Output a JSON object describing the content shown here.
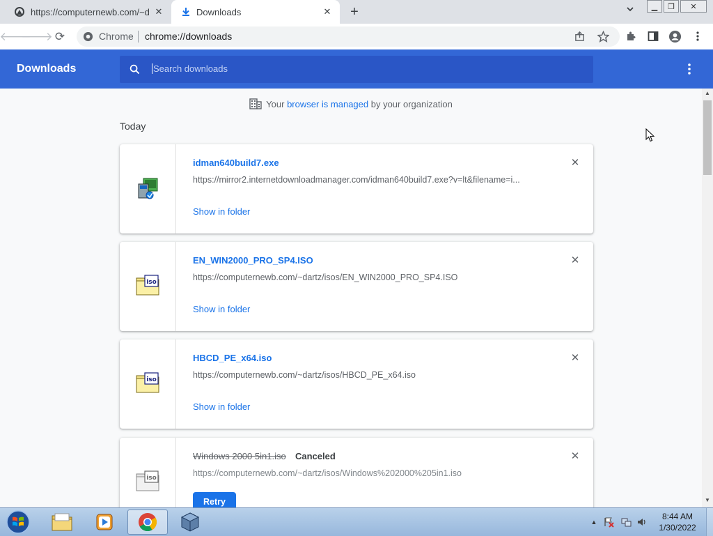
{
  "tabs": [
    {
      "title": "https://computernewb.com/~dartz",
      "active": false
    },
    {
      "title": "Downloads",
      "active": true
    }
  ],
  "toolbar": {
    "omnibox_label": "Chrome",
    "omnibox_url": "chrome://downloads"
  },
  "header": {
    "title": "Downloads",
    "search_placeholder": "Search downloads"
  },
  "managed": {
    "prefix": "Your ",
    "link": "browser is managed",
    "suffix": " by your organization"
  },
  "section_label": "Today",
  "downloads": [
    {
      "name": "idman640build7.exe",
      "url": "https://mirror2.internetdownloadmanager.com/idman640build7.exe?v=lt&filename=i...",
      "action": "Show in folder",
      "icon": "exe-installer-icon"
    },
    {
      "name": "EN_WIN2000_PRO_SP4.ISO",
      "url": "https://computernewb.com/~dartz/isos/EN_WIN2000_PRO_SP4.ISO",
      "action": "Show in folder",
      "icon": "iso-file-icon"
    },
    {
      "name": "HBCD_PE_x64.iso",
      "url": "https://computernewb.com/~dartz/isos/HBCD_PE_x64.iso",
      "action": "Show in folder",
      "icon": "iso-file-icon"
    },
    {
      "name": "Windows 2000 5in1.iso",
      "status": "Canceled",
      "url": "https://computernewb.com/~dartz/isos/Windows%202000%205in1.iso",
      "action": "Retry",
      "icon": "iso-file-icon"
    }
  ],
  "taskbar": {
    "apps": [
      "explorer-icon",
      "media-player-icon",
      "chrome-icon",
      "virtualbox-icon"
    ],
    "clock_time": "8:44 AM",
    "clock_date": "1/30/2022"
  },
  "colors": {
    "header_blue": "#3367d6",
    "link_blue": "#1a73e8"
  }
}
